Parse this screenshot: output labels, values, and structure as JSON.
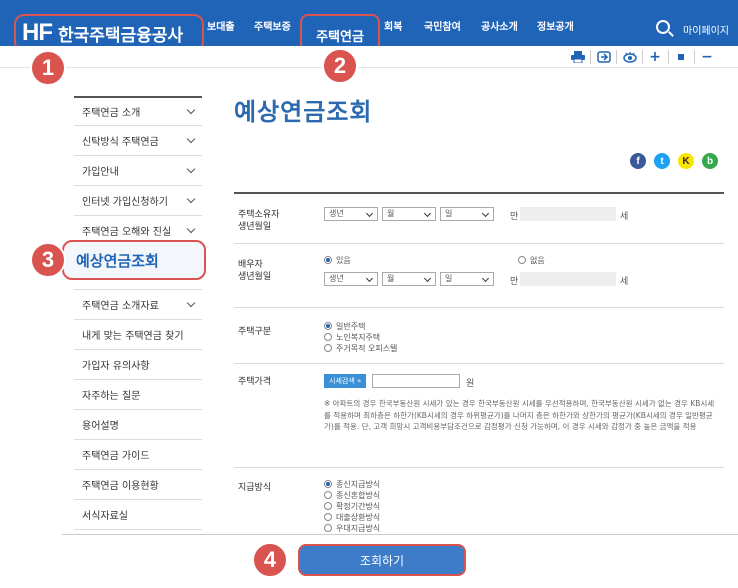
{
  "header": {
    "logo_mark": "HF",
    "logo_text": "한국주택금융공사",
    "nav": [
      "보대출",
      "주택보증",
      "회복",
      "국민참여",
      "공사소개",
      "정보공개"
    ],
    "nav_active": "주택연금",
    "mypage": "마이페이지"
  },
  "toolbar": {
    "icons": [
      "print-icon",
      "share-icon",
      "eye-icon",
      "zoom-in-icon",
      "stop-icon",
      "zoom-out-icon"
    ],
    "plus": "+",
    "minus": "−"
  },
  "badges": [
    "1",
    "2",
    "3",
    "4"
  ],
  "sidebar": {
    "items": [
      {
        "label": "주택연금 소개",
        "chevron": true
      },
      {
        "label": "신탁방식 주택연금",
        "chevron": true
      },
      {
        "label": "가입안내",
        "chevron": true
      },
      {
        "label": "인터넷 가입신청하기",
        "chevron": true
      },
      {
        "label": "주택연금 오해와 진실",
        "chevron": true
      },
      {
        "label": "주택연금 소개자료",
        "chevron": true
      },
      {
        "label": "내게 맞는 주택연금 찾기",
        "chevron": false
      },
      {
        "label": "가입자 유의사항",
        "chevron": false
      },
      {
        "label": "자주하는 질문",
        "chevron": false
      },
      {
        "label": "용어설명",
        "chevron": false
      },
      {
        "label": "주택연금 가이드",
        "chevron": false
      },
      {
        "label": "주택연금 이용현황",
        "chevron": false
      },
      {
        "label": "서식자료실",
        "chevron": false
      }
    ],
    "active": "예상연금조회"
  },
  "page": {
    "title": "예상연금조회"
  },
  "share": {
    "facebook": "f",
    "twitter": "t",
    "kakao": "K",
    "band": "b"
  },
  "form": {
    "owner": {
      "label1": "주택소유자",
      "label2": "생년월일",
      "year": "생년",
      "month": "월",
      "day": "일",
      "age_prefix": "만",
      "age_suffix": "세"
    },
    "spouse": {
      "label1": "배우자",
      "label2": "생년월일",
      "has": "있음",
      "none": "없음",
      "year": "생년",
      "month": "월",
      "day": "일",
      "age_prefix": "만",
      "age_suffix": "세"
    },
    "house_type": {
      "label": "주택구분",
      "options": [
        "일반주택",
        "노인복지주택",
        "주거목적 오피스텔"
      ]
    },
    "price": {
      "label": "주택가격",
      "search_button": "시세검색 »",
      "unit": "원",
      "note": "※ 아파트의 경우 한국부동산원 시세가 있는 경우 한국부동산원 시세를 우선적용하며, 한국부동산원 시세가 없는 경우 KB시세를 적용하며 최하층은 하한가(KB시세의 경우 하위평균가)를 나머지 층은 하한가와 상한가의 평균가(KB시세의 경우 일반평균가)를 적용. 단, 고객 희망시 고객비용부담조건으로 감정평가 신청 가능하며, 이 경우 시세와 감정가 중 높은 금액을 적용"
    },
    "payment": {
      "label": "지급방식",
      "options": [
        "종신지급방식",
        "종신혼합방식",
        "확정기간방식",
        "대출상환방식",
        "우대지급방식"
      ]
    }
  },
  "submit_label": "조회하기"
}
